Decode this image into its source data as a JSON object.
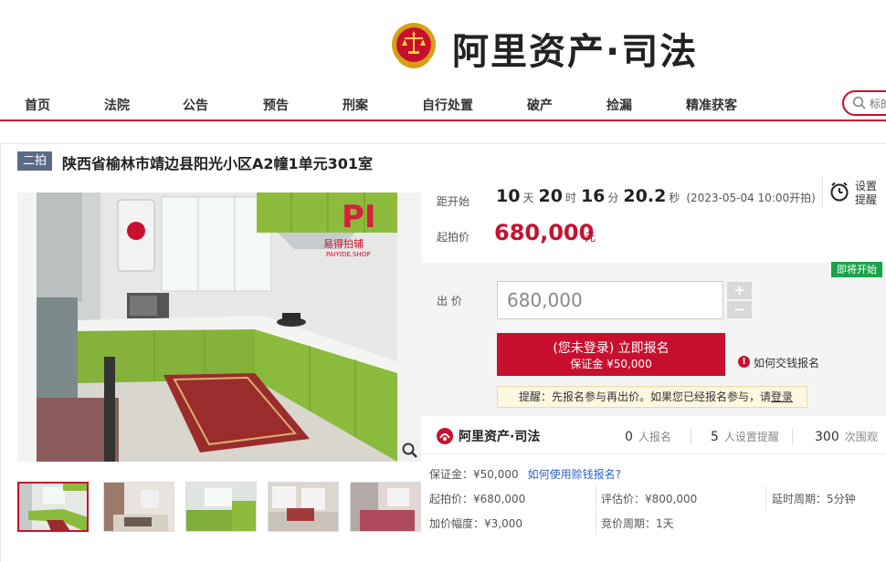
{
  "brand": {
    "title": "阿里资产·司法"
  },
  "nav": {
    "items": [
      "首页",
      "法院",
      "公告",
      "预告",
      "刑案",
      "自行处置",
      "破产",
      "捡漏",
      "精准获客"
    ],
    "search_placeholder": "标的"
  },
  "item": {
    "badge": "二拍",
    "title": "陕西省榆林市靖边县阳光小区A2幢1单元301室"
  },
  "photo": {
    "watermark_main": "易得拍辅",
    "watermark_sub": "PAIYIDE.SHOP"
  },
  "countdown": {
    "label": "距开始",
    "days": "10",
    "days_unit": "天",
    "hours": "20",
    "hours_unit": "时",
    "minutes": "16",
    "minutes_unit": "分",
    "seconds": "20.2",
    "seconds_unit": "秒",
    "start": "(2023-05-04 10:00开拍)"
  },
  "alarm": {
    "line1": "设置",
    "line2": "提醒"
  },
  "start_price": {
    "label": "起拍价",
    "value": "680,000",
    "unit": "元"
  },
  "bid": {
    "status_badge": "即将开始",
    "label": "出 价",
    "value": "680,000",
    "plus": "+",
    "minus": "−",
    "signup_line1": "(您未登录) 立即报名",
    "signup_line2": "保证金 ¥50,000",
    "how_pay": "如何交钱报名",
    "tip_text": "提醒：先报名参与再出价。如果您已经报名参与，请",
    "tip_login": "登录"
  },
  "stats": {
    "brand": "阿里资产·司法",
    "signups": {
      "n": "0",
      "u": "人报名"
    },
    "reminders": {
      "n": "5",
      "u": "人设置提醒"
    },
    "views": {
      "n": "300",
      "u": "次围观"
    }
  },
  "details": {
    "deposit": "保证金：¥50,000",
    "deposit_link": "如何使用赊钱报名?",
    "start_price": "起拍价：¥680,000",
    "appraisal": "评估价：¥800,000",
    "delay": "延时周期：5分钟",
    "increment": "加价幅度：¥3,000",
    "cycle": "竞价周期：1天"
  },
  "colors": {
    "accent": "#c8102e",
    "badge": "#5b6b86",
    "green": "#1aa34a"
  }
}
